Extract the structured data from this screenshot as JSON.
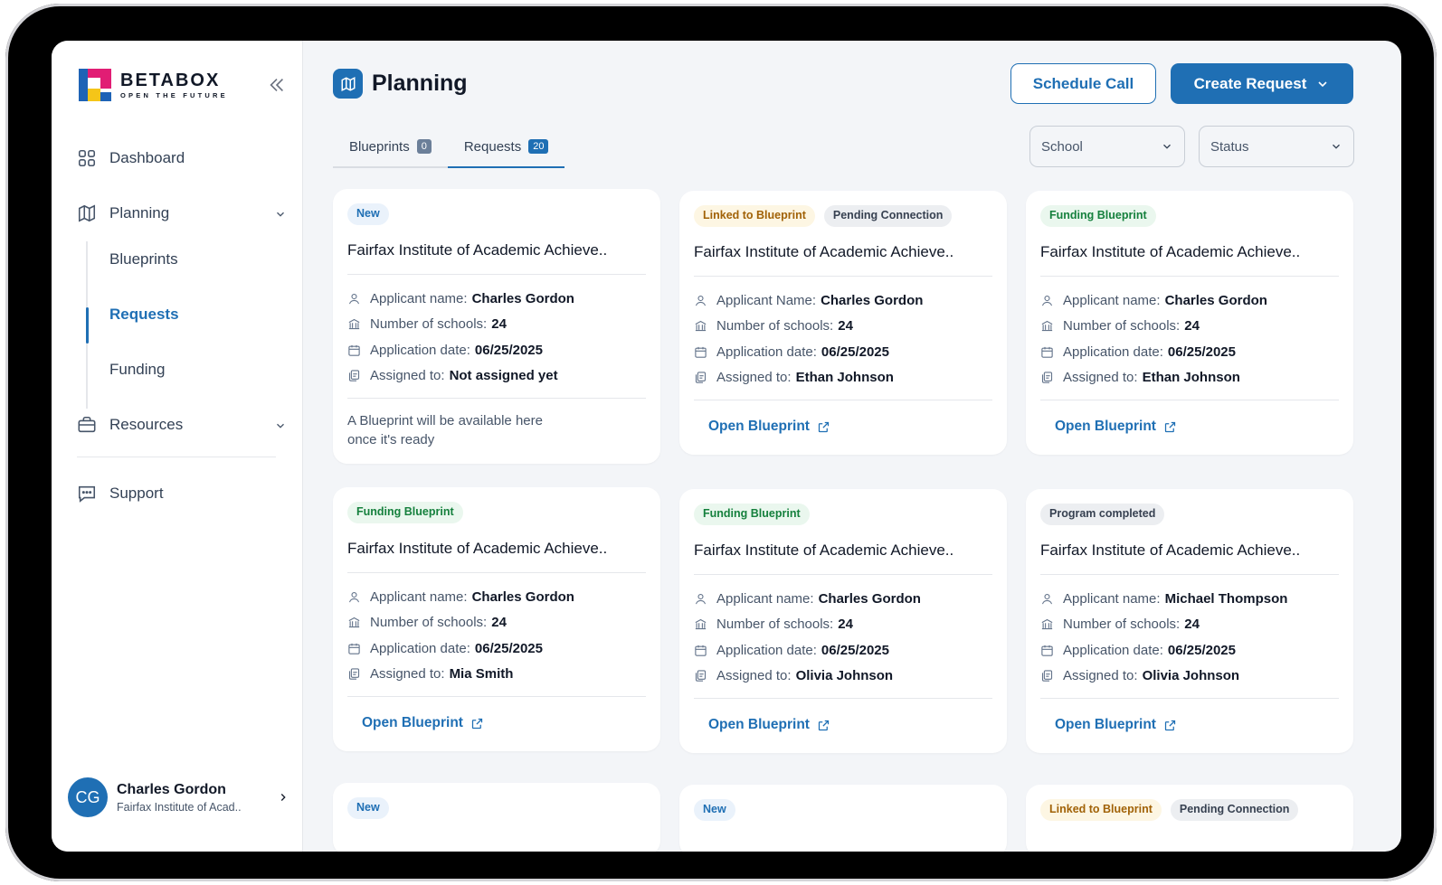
{
  "brand": {
    "title": "BETABOX",
    "subtitle": "OPEN THE FUTURE"
  },
  "sidebar": {
    "items": [
      {
        "label": "Dashboard"
      },
      {
        "label": "Planning"
      },
      {
        "label": "Resources"
      },
      {
        "label": "Support"
      }
    ],
    "planning_sub": [
      {
        "label": "Blueprints"
      },
      {
        "label": "Requests"
      },
      {
        "label": "Funding"
      }
    ]
  },
  "user": {
    "initials": "CG",
    "name": "Charles Gordon",
    "org": "Fairfax Institute of Acad.."
  },
  "header": {
    "title": "Planning",
    "schedule_label": "Schedule Call",
    "create_label": "Create Request"
  },
  "tabs": [
    {
      "label": "Blueprints",
      "count": "0"
    },
    {
      "label": "Requests",
      "count": "20"
    }
  ],
  "filters": {
    "school": "School",
    "status": "Status"
  },
  "labels": {
    "applicant": "Applicant name:",
    "applicant_alt": "Applicant Name:",
    "schools": "Number of schools:",
    "date": "Application date:",
    "assigned": "Assigned to:",
    "open_blueprint": "Open Blueprint",
    "pending_note": "A Blueprint will be available here once it's ready"
  },
  "cards": [
    {
      "badges": [
        "New"
      ],
      "title": "Fairfax Institute of  Academic Achieve..",
      "applicant": "Charles Gordon",
      "schools": "24",
      "date": "06/25/2025",
      "assigned": "Not assigned yet"
    },
    {
      "badges": [
        "Linked to Blueprint",
        "Pending Connection"
      ],
      "title": "Fairfax Institute of  Academic Achieve..",
      "applicant": "Charles Gordon",
      "schools": "24",
      "date": "06/25/2025",
      "assigned": "Ethan Johnson"
    },
    {
      "badges": [
        "Funding Blueprint"
      ],
      "title": "Fairfax Institute of  Academic Achieve..",
      "applicant": "Charles Gordon",
      "schools": "24",
      "date": "06/25/2025",
      "assigned": "Ethan Johnson"
    },
    {
      "badges": [
        "Funding Blueprint"
      ],
      "title": "Fairfax Institute of  Academic Achieve..",
      "applicant": "Charles Gordon",
      "schools": "24",
      "date": "06/25/2025",
      "assigned": "Mia Smith"
    },
    {
      "badges": [
        "Funding Blueprint"
      ],
      "title": "Fairfax Institute of  Academic Achieve..",
      "applicant": "Charles Gordon",
      "schools": "24",
      "date": "06/25/2025",
      "assigned": "Olivia Johnson"
    },
    {
      "badges": [
        "Program completed"
      ],
      "title": "Fairfax Institute of  Academic Achieve..",
      "applicant": "Michael Thompson",
      "schools": "24",
      "date": "06/25/2025",
      "assigned": "Olivia Johnson"
    },
    {
      "badges": [
        "New"
      ]
    },
    {
      "badges": [
        "New"
      ]
    },
    {
      "badges": [
        "Linked to Blueprint",
        "Pending Connection"
      ]
    }
  ],
  "colors": {
    "accent": "#1f6fb4",
    "tab_count_inactive": "#6b7f99"
  }
}
